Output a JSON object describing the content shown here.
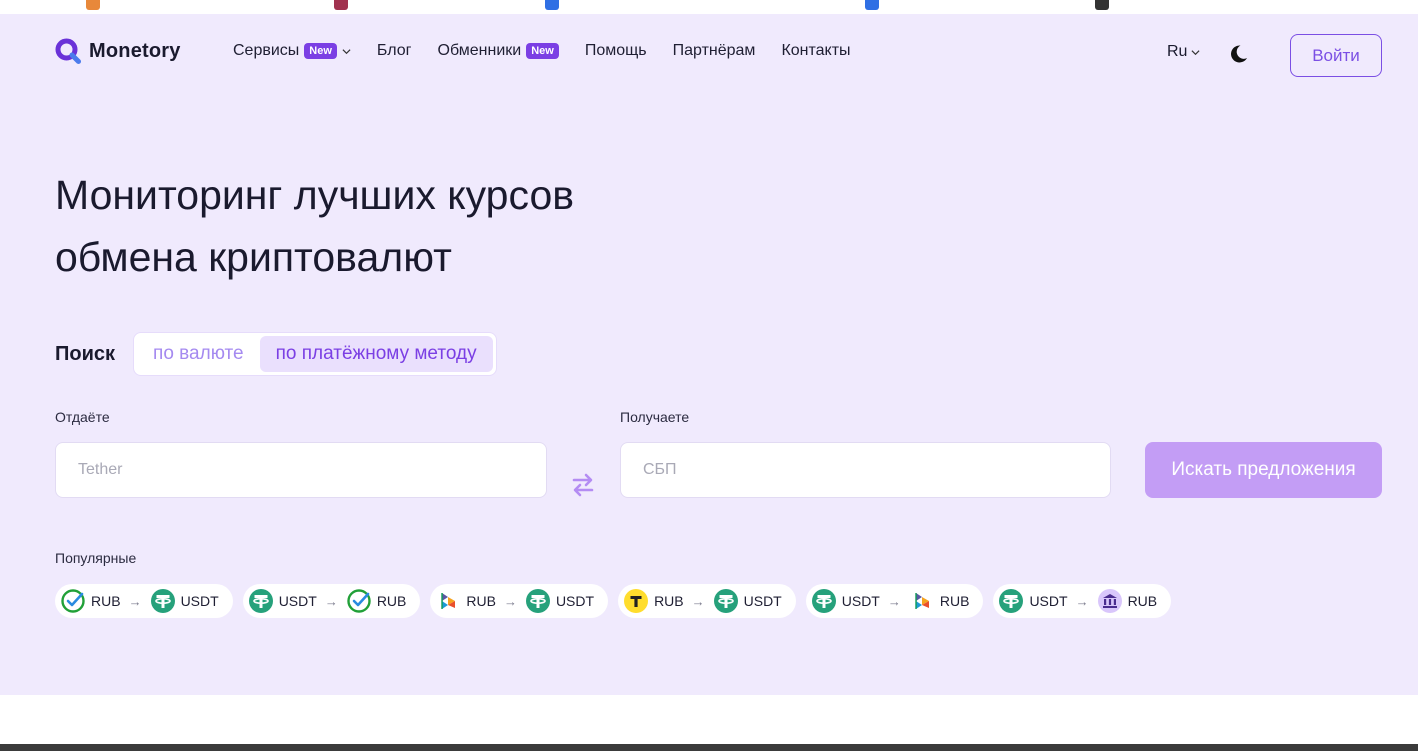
{
  "header": {
    "logo_text": "Monetory",
    "menu": [
      {
        "label": "Сервисы",
        "badge": "New",
        "has_dropdown": true
      },
      {
        "label": "Блог"
      },
      {
        "label": "Обменники",
        "badge": "New"
      },
      {
        "label": "Помощь"
      },
      {
        "label": "Партнёрам"
      },
      {
        "label": "Контакты"
      }
    ],
    "language": "Ru",
    "login_label": "Войти"
  },
  "hero": {
    "title_line1": "Мониторинг лучших курсов",
    "title_line2": "обмена криптовалют"
  },
  "search": {
    "label": "Поиск",
    "tabs": [
      {
        "label": "по валюте",
        "active": false
      },
      {
        "label": "по платёжному методу",
        "active": true
      }
    ],
    "give_label": "Отдаёте",
    "give_value": "Tether",
    "receive_label": "Получаете",
    "receive_value": "СБП",
    "submit_label": "Искать предложения"
  },
  "popular": {
    "label": "Популярные",
    "pairs": [
      {
        "from_icon": "sber-check-icon",
        "from": "RUB",
        "to_icon": "tether-icon",
        "to": "USDT"
      },
      {
        "from_icon": "tether-icon",
        "from": "USDT",
        "to_icon": "sber-check-icon",
        "to": "RUB"
      },
      {
        "from_icon": "sbp-icon",
        "from": "RUB",
        "to_icon": "tether-icon",
        "to": "USDT"
      },
      {
        "from_icon": "tbank-icon",
        "from": "RUB",
        "to_icon": "tether-icon",
        "to": "USDT"
      },
      {
        "from_icon": "tether-icon",
        "from": "USDT",
        "to_icon": "sbp-icon",
        "to": "RUB"
      },
      {
        "from_icon": "tether-icon",
        "from": "USDT",
        "to_icon": "bank-icon",
        "to": "RUB"
      }
    ],
    "arrow": "→"
  },
  "colors": {
    "accent": "#7b3fe4",
    "hero_bg": "#f0eafd",
    "submit_bg": "#c39df5",
    "tether": "#26a17b"
  }
}
